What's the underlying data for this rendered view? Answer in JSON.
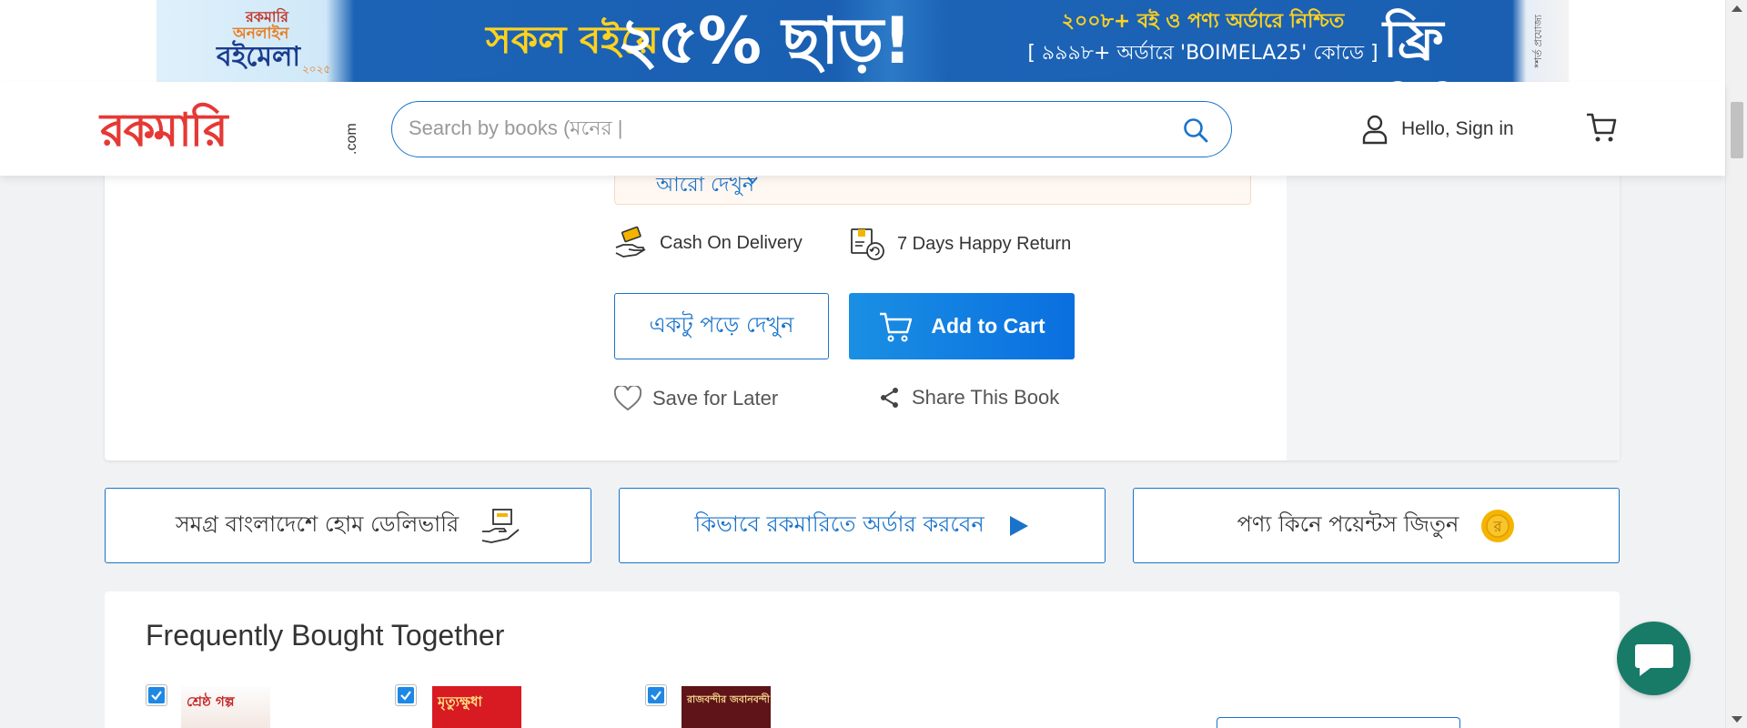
{
  "banner": {
    "brand_small": "রকমারি",
    "brand_online": "অনলাইন",
    "brand_title": "বইমেলা",
    "brand_year": "২০২৫",
    "headline_prefix": "সকল বইয়ে",
    "headline_discount": "২৫% ছাড়!",
    "offer_line1": "২০০৮+ বই ও পণ্য অর্ডারে নিশ্চিত",
    "offer_line2": "[ ৯৯৯৮+ অর্ডারে 'BOIMELA25' কোডে ]",
    "free_shipping": "ফ্রি শিপিং",
    "terms": "*শর্ত প্রযোজ্য"
  },
  "header": {
    "logo_text": "রকমারি",
    "logo_suffix": ".com",
    "search_placeholder": "Search by books (মনের |",
    "account_label": "Hello, Sign in"
  },
  "product": {
    "see_more": "আরো দেখুন",
    "features": [
      "Cash On Delivery",
      "7 Days Happy Return"
    ],
    "read_button": "একটু পড়ে দেখুন",
    "cart_button": "Add to Cart",
    "save_label": "Save for Later",
    "share_label": "Share This Book"
  },
  "info_boxes": [
    {
      "label": "সমগ্র বাংলাদেশে হোম ডেলিভারি",
      "color": "#333333"
    },
    {
      "label": "কিভাবে রকমারিতে অর্ডার করবেন",
      "color": "#1a73c9"
    },
    {
      "label": "পণ্য কিনে পয়েন্টস জিতুন",
      "color": "#333333"
    }
  ],
  "coin_letter": "র",
  "frequently_bought": {
    "title": "Frequently Bought Together",
    "books": [
      {
        "cover_text": "শ্রেষ্ঠ গল্প",
        "checked": true
      },
      {
        "cover_text": "মৃত্যুক্ষুধা",
        "checked": true
      },
      {
        "cover_text": "রাজবন্দীর জবানবন্দী",
        "checked": true
      }
    ]
  },
  "colors": {
    "accent": "#1a73c9",
    "cart_button": "#0a6fe0",
    "chat": "#177b68",
    "coin": "#f5b400"
  }
}
